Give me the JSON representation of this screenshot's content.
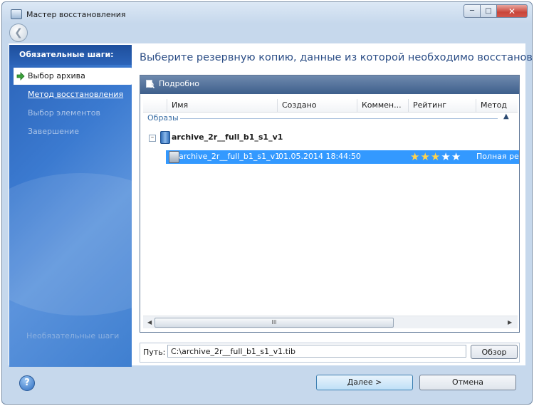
{
  "window": {
    "title": "Мастер восстановления"
  },
  "sidebar": {
    "heading": "Обязательные шаги:",
    "items": [
      {
        "label": "Выбор архива"
      },
      {
        "label": "Метод восстановления"
      },
      {
        "label": "Выбор элементов"
      },
      {
        "label": "Завершение"
      }
    ],
    "optional": "Необязательные шаги"
  },
  "main": {
    "heading": "Выберите резервную копию, данные из которой необходимо восстановить",
    "panel_title": "Подробно",
    "columns": [
      "Имя",
      "Создано",
      "Коммен...",
      "Рейтинг",
      "Метод"
    ],
    "group": "Образы",
    "archive_name": "archive_2r__full_b1_s1_v1",
    "rows": [
      {
        "name": "archive_2r__full_b1_s1_v1",
        "created": "01.05.2014 18:44:50",
        "comment": "",
        "rating": 3,
        "rating_max": 5,
        "method": "Полная резервная копия"
      }
    ]
  },
  "path": {
    "label": "Путь:",
    "value": "C:\\archive_2r__full_b1_s1_v1.tib",
    "browse": "Обзор"
  },
  "buttons": {
    "next": "Далее >",
    "cancel": "Отмена",
    "help": "?"
  },
  "scroll_glyph": "III"
}
